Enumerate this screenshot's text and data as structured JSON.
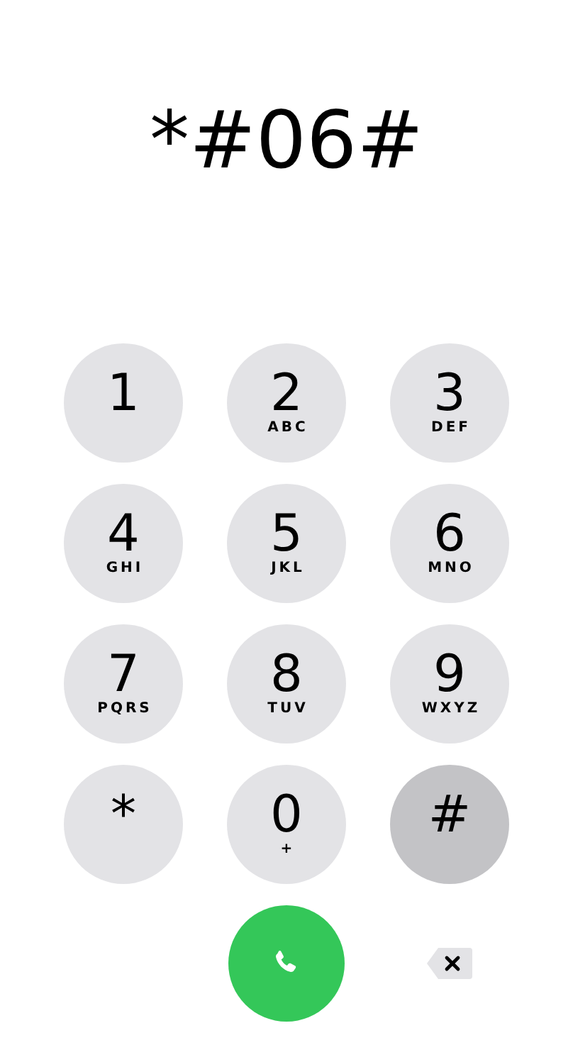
{
  "display": {
    "value": "*#06#"
  },
  "keys": [
    {
      "digit": "1",
      "selected": false
    },
    {
      "digit": "2",
      "letters": "ABC",
      "selected": false
    },
    {
      "digit": "3",
      "letters": "DEF",
      "selected": false
    },
    {
      "digit": "4",
      "letters": "GHI",
      "selected": false
    },
    {
      "digit": "5",
      "letters": "JKL",
      "selected": false
    },
    {
      "digit": "6",
      "letters": "MNO",
      "selected": false
    },
    {
      "digit": "7",
      "letters": "PQRS",
      "selected": false
    },
    {
      "digit": "8",
      "letters": "TUV",
      "selected": false
    },
    {
      "digit": "9",
      "letters": "WXYZ",
      "selected": false
    },
    {
      "digit": "*",
      "selected": false
    },
    {
      "digit": "0",
      "letters": "+",
      "selected": false
    },
    {
      "digit": "#",
      "selected": true
    }
  ]
}
